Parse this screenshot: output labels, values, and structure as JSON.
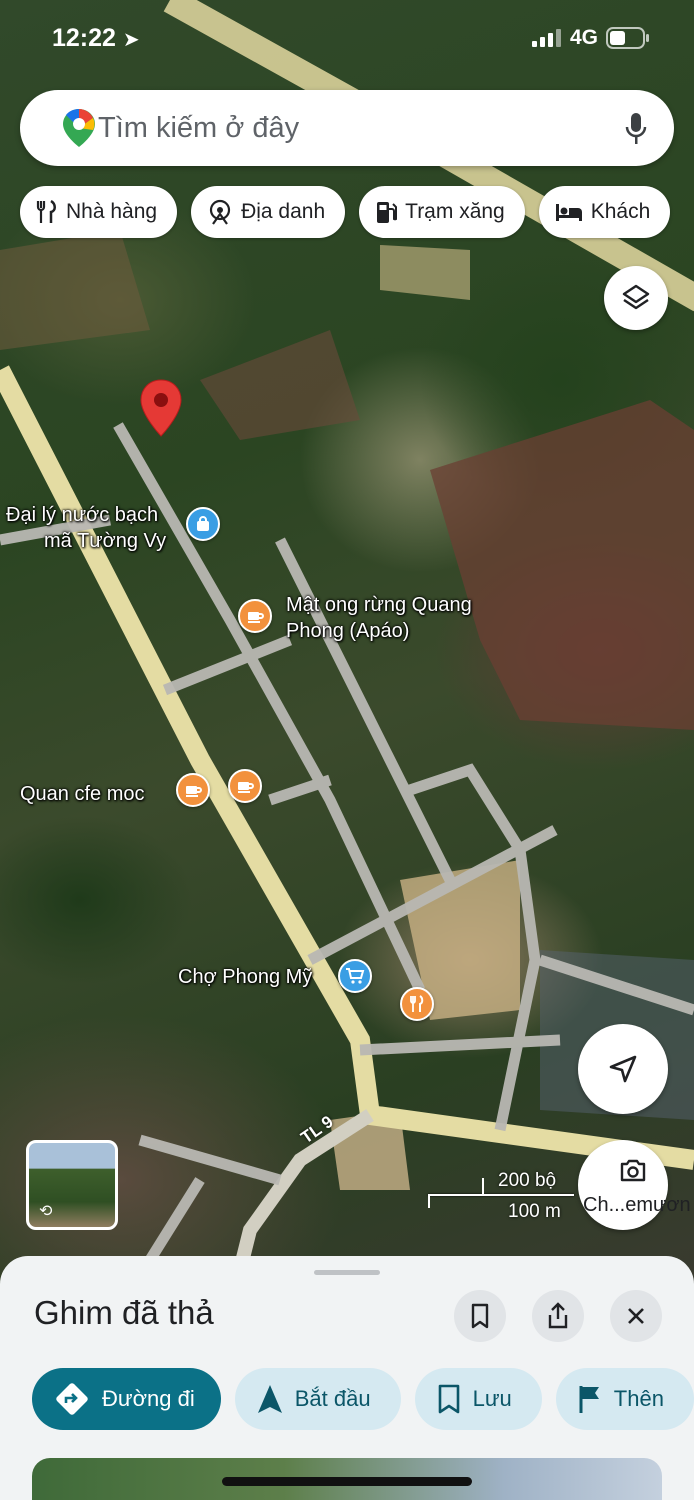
{
  "status_bar": {
    "time": "12:22",
    "network": "4G"
  },
  "search": {
    "placeholder": "Tìm kiếm ở đây"
  },
  "chips": [
    {
      "label": "Nhà hàng",
      "icon": "fork-knife-icon"
    },
    {
      "label": "Địa danh",
      "icon": "landmark-icon"
    },
    {
      "label": "Trạm xăng",
      "icon": "gas-station-icon"
    },
    {
      "label": "Khách",
      "icon": "bed-icon"
    }
  ],
  "map": {
    "pois": {
      "water_shop": {
        "label_line1": "Đại lý nước bạch",
        "label_line2": "mã Tường Vy",
        "icon": "shopping-bag-icon"
      },
      "honey_shop": {
        "label_line1": "Mật ong rừng Quang",
        "label_line2": "Phong (Apáo)",
        "icon": "coffee-icon"
      },
      "cafe": {
        "label": "Quan cfe moc",
        "icon": "coffee-icon"
      },
      "market": {
        "label": "Chợ Phong Mỹ",
        "icon": "shopping-cart-icon"
      }
    },
    "road_label": "TL 9",
    "scale": {
      "imperial": "200 bộ",
      "metric": "100 m"
    },
    "lens_label": "Ch...emươn"
  },
  "sheet": {
    "title": "Ghim đã thả",
    "actions": {
      "directions": "Đường đi",
      "start": "Bắt đầu",
      "save": "Lưu",
      "more": "Thên"
    }
  }
}
